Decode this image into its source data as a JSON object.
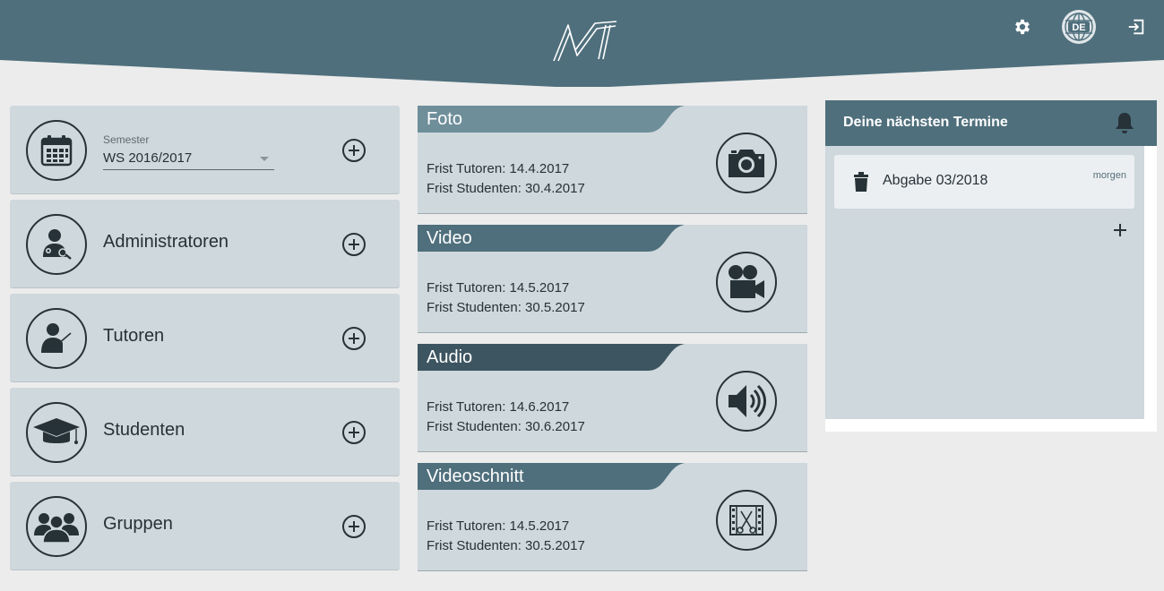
{
  "header": {
    "logo": "MT",
    "icons": [
      "gear-icon",
      "language-globe-icon",
      "logout-icon"
    ],
    "language_badge": "DE",
    "color": "#4f6f7c"
  },
  "left": {
    "semester": {
      "label": "Semester",
      "value": "WS 2016/2017",
      "icon": "calendar-icon"
    },
    "items": [
      {
        "label": "Administratoren",
        "icon": "admin-user-icon"
      },
      {
        "label": "Tutoren",
        "icon": "tutor-icon"
      },
      {
        "label": "Studenten",
        "icon": "graduation-cap-icon"
      },
      {
        "label": "Gruppen",
        "icon": "group-icon"
      }
    ]
  },
  "modules": [
    {
      "title": "Foto",
      "line1": "Frist Tutoren: 14.4.2017",
      "line2": "Frist Studenten: 30.4.2017",
      "icon": "camera-icon",
      "color": "#6e8e9a"
    },
    {
      "title": "Video",
      "line1": "Frist Tutoren: 14.5.2017",
      "line2": "Frist Studenten: 30.5.2017",
      "icon": "video-camera-icon",
      "color": "#4f6f7c"
    },
    {
      "title": "Audio",
      "line1": "Frist Tutoren: 14.6.2017",
      "line2": "Frist Studenten: 30.6.2017",
      "icon": "speaker-icon",
      "color": "#3d5561"
    },
    {
      "title": "Videoschnitt",
      "line1": "Frist Tutoren: 14.5.2017",
      "line2": "Frist Studenten: 30.5.2017",
      "icon": "film-cut-icon",
      "color": "#4f6f7c"
    }
  ],
  "appointments": {
    "title": "Deine nächsten Termine",
    "items": [
      {
        "title": "Abgabe 03/2018",
        "when": "morgen"
      }
    ]
  }
}
